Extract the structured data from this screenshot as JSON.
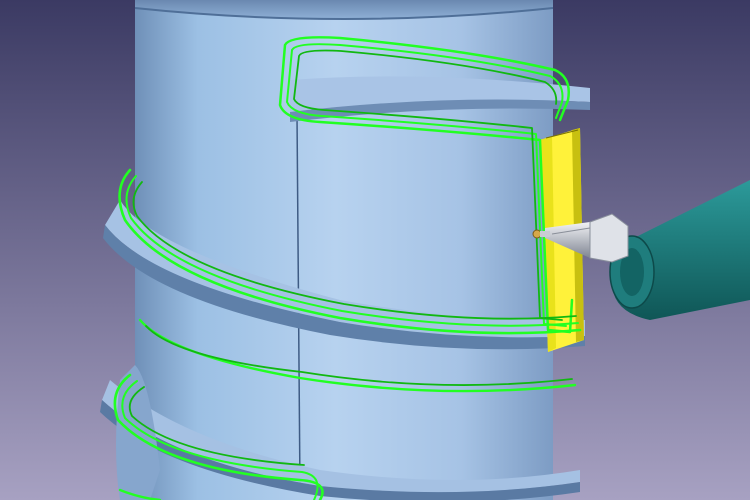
{
  "scene": {
    "viewport_label": "",
    "colors": {
      "background_top": "#3b3a63",
      "background_bottom": "#a7a1c2",
      "part_light": "#b8d2ef",
      "part_mid": "#95b3d8",
      "part_dark": "#5f7fa6",
      "part_shadow": "#3f5d86",
      "toolpath": "#22ff22",
      "toolpath_dark": "#11b811",
      "pocket_wall": "#e9e21b",
      "pocket_floor": "#fff23a",
      "spindle": "#1f7d7d",
      "spindle_dark": "#0f5656",
      "tool_holder": "#c9ccd3",
      "tool_tip": "#d6a84a"
    },
    "objects": [
      {
        "name": "cylindrical-workpiece",
        "type": "cylinder"
      },
      {
        "name": "helical-groove",
        "type": "groove"
      },
      {
        "name": "yellow-pocket",
        "type": "machined-surface"
      },
      {
        "name": "end-mill",
        "type": "cutting-tool"
      },
      {
        "name": "spindle",
        "type": "machine-head"
      }
    ],
    "toolpath_passes": 3
  }
}
